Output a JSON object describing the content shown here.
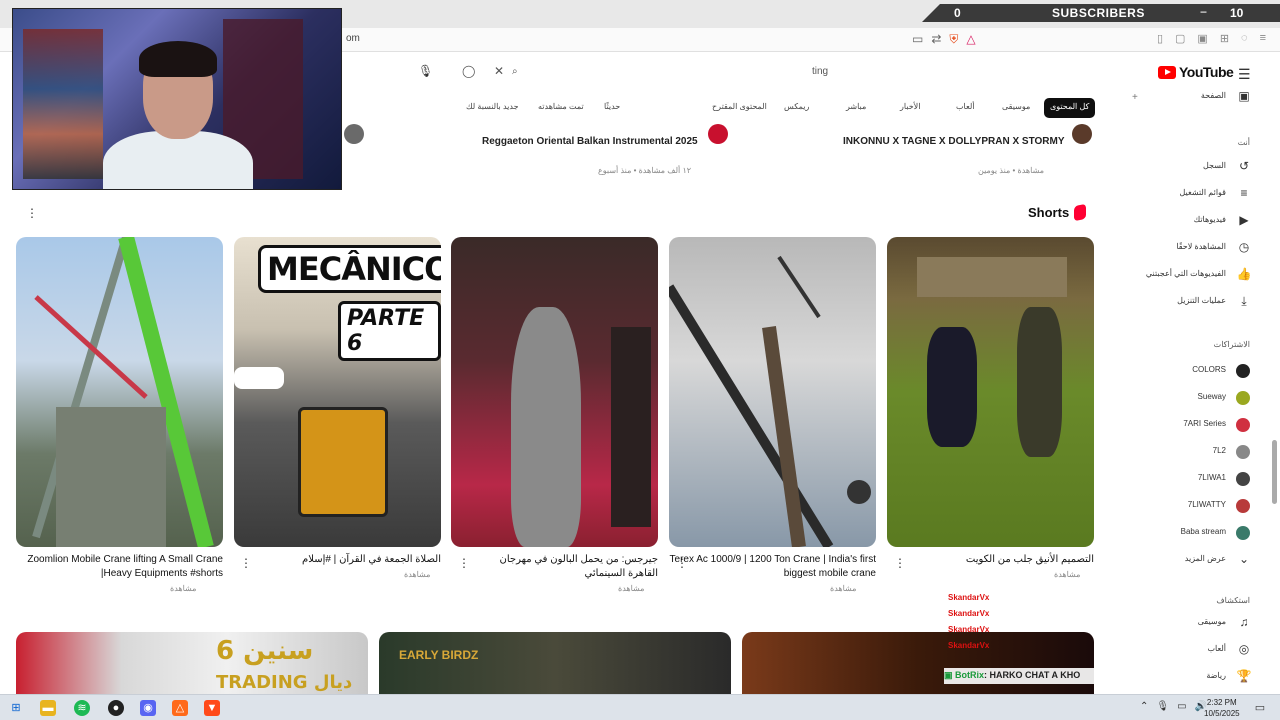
{
  "browser": {
    "address_fragment": "om",
    "search_text": "ting"
  },
  "overlay": {
    "sub_count": "0",
    "sub_label": "SUBSCRIBERS",
    "sub_minus": "−",
    "sub_goal": "10"
  },
  "youtube": {
    "logo_text": "YouTube",
    "chips": [
      {
        "label": "كل المحتوى",
        "active": true
      },
      {
        "label": "موسيقى"
      },
      {
        "label": "ألعاب"
      },
      {
        "label": "الأخبار"
      },
      {
        "label": "مباشر"
      },
      {
        "label": "ريمكس"
      },
      {
        "label": "المحتوى المقترح"
      },
      {
        "label": "حديثًا"
      },
      {
        "label": "تمت مشاهدته"
      },
      {
        "label": "جديد بالنسبة لك"
      }
    ],
    "prev_videos": [
      {
        "title": "Reggaeton Oriental Balkan Instrumental 2025",
        "meta": "١٢ ألف مشاهدة • منذ أسبوع"
      },
      {
        "title": "INKONNU X TAGNE X DOLLYPRAN X STORMY",
        "meta": "مشاهدة • منذ يومين"
      }
    ],
    "shorts_heading": "Shorts",
    "shorts": [
      {
        "title": "Zoomlion Mobile Crane lifting A Small Crane |Heavy Equipments #shorts",
        "meta": "مشاهدة"
      },
      {
        "title": "الصلاة الجمعة في القرآن | #إسلام",
        "meta": "مشاهدة"
      },
      {
        "title": "جيرجس: من يحمل البالون في مهرجان القاهرة السينمائي",
        "meta": "مشاهدة"
      },
      {
        "title": "Terex Ac 1000/9 | 1200 Ton Crane | India's first biggest mobile crane",
        "meta": "مشاهدة"
      },
      {
        "title": "التصميم الأنيق جلب من الكويت",
        "meta": "مشاهدة"
      }
    ],
    "mechanico_text": "MECÂNICO",
    "parte_text": "PARTE 6",
    "bottom_cards": [
      {
        "text_top": "6 سنين",
        "text_bottom": "TRADING ديال"
      },
      {
        "text_top": "EARLY BIRDZ"
      },
      {
        "text_top": ""
      }
    ]
  },
  "chat": {
    "names": [
      "SkandarVx",
      "SkandarVx",
      "SkandarVx",
      "SkandarVx",
      "SkandarVx"
    ],
    "bot_name": "BotRix",
    "bot_message": ": HARKO CHAT A KHO"
  },
  "sidebar": {
    "home_label": "الصفحة",
    "you_label": "أنت",
    "items": [
      {
        "label": "السجل",
        "icon": "history-icon"
      },
      {
        "label": "قوائم التشغيل",
        "icon": "playlist-icon"
      },
      {
        "label": "فيديوهاتك",
        "icon": "video-icon"
      },
      {
        "label": "المشاهدة لاحقًا",
        "icon": "clock-icon"
      },
      {
        "label": "الفيديوهات التي أعجبتني",
        "icon": "like-icon"
      },
      {
        "label": "عمليات التنزيل",
        "icon": "download-icon"
      }
    ],
    "subs_heading": "الاشتراكات",
    "subs": [
      {
        "label": "COLORS",
        "color": "#222222"
      },
      {
        "label": "Sueway",
        "color": "#9aa820"
      },
      {
        "label": "7ARI Series",
        "color": "#d03040"
      },
      {
        "label": "7L2",
        "color": "#888888"
      },
      {
        "label": "7LIWA1",
        "color": "#444444"
      },
      {
        "label": "7LIWATTY",
        "color": "#b83a3a"
      },
      {
        "label": "Baba stream",
        "color": "#3a7a6a"
      }
    ],
    "show_more": "عرض المزيد",
    "explore_heading": "استكشاف",
    "explore": [
      {
        "label": "موسيقى",
        "icon": "music-icon"
      },
      {
        "label": "ألعاب",
        "icon": "gamepad-icon"
      },
      {
        "label": "رياضة",
        "icon": "trophy-icon"
      }
    ]
  },
  "taskbar": {
    "time": "2:32 PM",
    "date": "10/5/2025"
  }
}
